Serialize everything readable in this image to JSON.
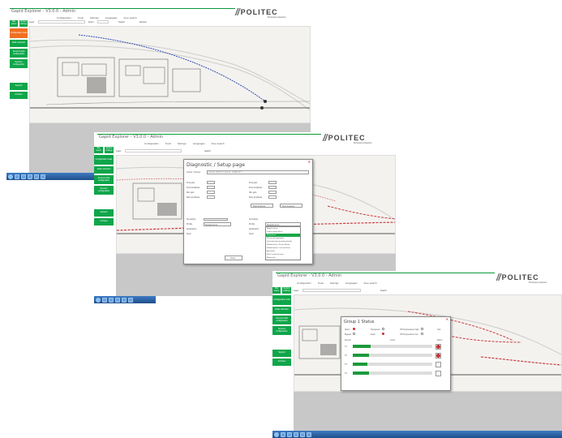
{
  "app": {
    "title": "Gapid Explorer - V3.0.0 - Admin",
    "menu": [
      "Configuration",
      "Tools",
      "Settings",
      "Languages",
      "Free search"
    ],
    "brand": "POLITEC",
    "brand_sub": "Perimeter protection"
  },
  "toolbar": {
    "layer": "Layer:",
    "zoom": "Zoom:",
    "search": "Search",
    "refresh": "Refresh"
  },
  "sidebar": {
    "top": [
      "Site select",
      "System settings"
    ],
    "items": [
      "Configuration tools",
      "Node selection",
      "Sensors field configuration",
      "Sensors configuration",
      "Support",
      "Archives"
    ]
  },
  "dialog1": {
    "title": "Diagnostic / Setup page",
    "group_label": "Group / Sensor:",
    "group_value": "Group1 Wall-D1 Infrared - MidDev6.T",
    "left_fields": [
      "Find gain",
      "Find amplitude",
      "Min gain",
      "Max amplitude"
    ],
    "right_fields": [
      "Find gain",
      "Find amplitude",
      "Min gain",
      "Max amplitude"
    ],
    "btn_start": "Start Analysis",
    "btn_stop": "Stop Analysis",
    "lower_left": [
      "Sensitivity",
      "Profile",
      "Application",
      "Field"
    ],
    "lower_right": [
      "Sensitivity",
      "Profile",
      "Application",
      "Field"
    ],
    "profile_value": "Regular fence",
    "dropdown": [
      "Regular fence",
      "Linear sensor fence",
      "Weak fence",
      "Fence with rigid poles",
      "Concrete fencing and horizontal",
      "Welded mesh / Fence Barrier",
      "Welded panel - concrete base",
      "Anti-climb",
      "Roof / small structure",
      "Motorcycle"
    ],
    "dropdown_selected": 2,
    "close_btn": "Close"
  },
  "dialog2": {
    "title": "Group 1 Status",
    "legend": [
      "Alarm",
      "Tampered",
      "Bypass",
      "Fault",
      "Off Temperature high",
      "Off Temperature low",
      "Ack"
    ],
    "columns": [
      "Sensor",
      "Level",
      "Alarm"
    ],
    "rows": [
      {
        "label": "T1",
        "level": 0.22
      },
      {
        "label": "T2",
        "level": 0.2
      },
      {
        "label": "T3",
        "level": 0.18
      },
      {
        "label": "T4",
        "level": 0.2
      }
    ]
  },
  "colors": {
    "accent": "#0fa64a",
    "orange": "#f07020",
    "alarm": "#d02a2a",
    "route": "#2f4fb5"
  }
}
